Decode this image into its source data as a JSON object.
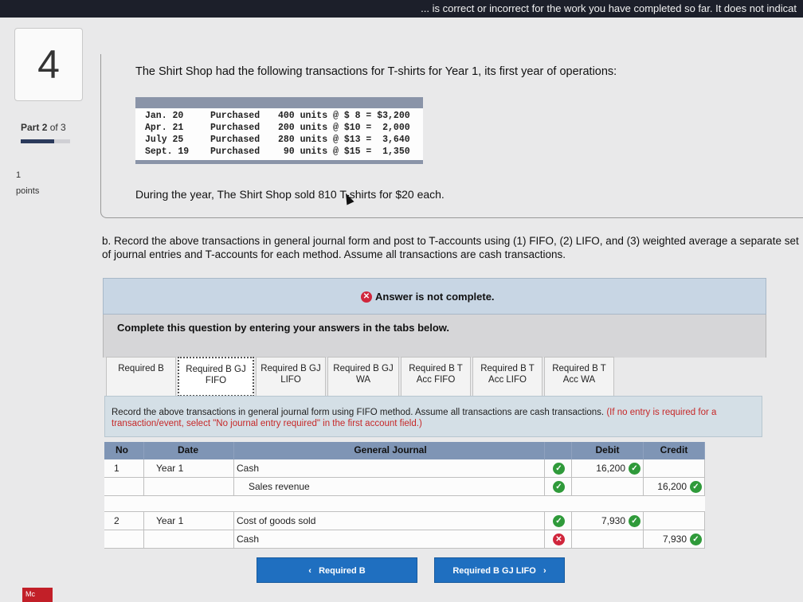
{
  "topbar": {
    "text": "... is correct or incorrect for the work you have completed so far. It does not indicat"
  },
  "question": {
    "number": "4",
    "part_prefix": "Part",
    "part_number": "2",
    "part_of": "of 3",
    "part_progress": 0.67,
    "points_value": "1",
    "points_label": "points",
    "intro": "The Shirt Shop had the following transactions for T-shirts for Year 1, its first year of operations:",
    "transactions": [
      {
        "date": "Jan. 20",
        "type": "Purchased",
        "detail": "400 units @ $ 8 = $3,200"
      },
      {
        "date": "Apr. 21",
        "type": "Purchased",
        "detail": "200 units @ $10 =  2,000"
      },
      {
        "date": "July 25",
        "type": "Purchased",
        "detail": "280 units @ $13 =  3,640"
      },
      {
        "date": "Sept. 19",
        "type": "Purchased",
        "detail": " 90 units @ $15 =  1,350"
      }
    ],
    "during": "During the year, The Shirt Shop sold 810 T-shirts for $20 each.",
    "part_b": "b. Record the above transactions in general journal form and post to T-accounts using (1) FIFO, (2) LIFO, and (3) weighted average a separate set of journal entries and T-accounts for each method. Assume all transactions are cash transactions."
  },
  "answer_status": "Answer is not complete.",
  "complete_prompt": "Complete this question by entering your answers in the tabs below.",
  "tabs": [
    {
      "label": "Required B"
    },
    {
      "label": "Required B GJ FIFO"
    },
    {
      "label": "Required B GJ LIFO"
    },
    {
      "label": "Required B GJ WA"
    },
    {
      "label": "Required B T Acc FIFO"
    },
    {
      "label": "Required B T Acc LIFO"
    },
    {
      "label": "Required B T Acc WA"
    }
  ],
  "instructions": {
    "main": "Record the above transactions in general journal form using FIFO method. Assume all transactions are cash transactions.",
    "note": "(If no entry is required for a transaction/event, select \"No journal entry required\" in the first account field.)"
  },
  "journal": {
    "headers": {
      "no": "No",
      "date": "Date",
      "account": "General Journal",
      "debit": "Debit",
      "credit": "Credit"
    },
    "entries": [
      {
        "no": "1",
        "date": "Year 1",
        "account": "Cash",
        "debit": "16,200",
        "credit": "",
        "account_status": "correct",
        "debit_status": "correct",
        "credit_status": ""
      },
      {
        "no": "",
        "date": "",
        "account": "Sales revenue",
        "debit": "",
        "credit": "16,200",
        "account_status": "correct",
        "debit_status": "",
        "credit_status": "correct"
      },
      {
        "no": "2",
        "date": "Year 1",
        "account": "Cost of goods sold",
        "debit": "7,930",
        "credit": "",
        "account_status": "correct",
        "debit_status": "correct",
        "credit_status": ""
      },
      {
        "no": "",
        "date": "",
        "account": "Cash",
        "debit": "",
        "credit": "7,930",
        "account_status": "incorrect",
        "debit_status": "",
        "credit_status": "correct"
      }
    ]
  },
  "nav": {
    "prev_label": "Required B",
    "next_label": "Required B GJ LIFO"
  },
  "footer": {
    "logo": "Mc"
  },
  "colors": {
    "header_blue": "#7f95b5",
    "correct_green": "#2f9a3a",
    "incorrect_red": "#d0263c",
    "nav_blue": "#1f6fc0"
  }
}
